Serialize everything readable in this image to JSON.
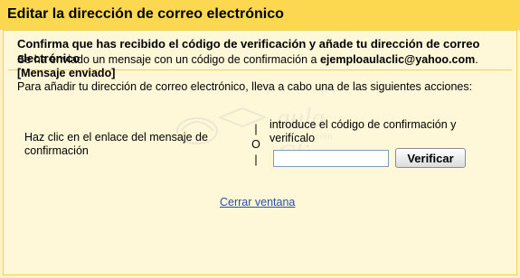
{
  "window": {
    "title": "Editar la dirección de correo electrónico"
  },
  "header": {
    "text": "Confirma que has recibido el código de verificación y añade tu dirección de correo electrónico"
  },
  "info": {
    "line1_prefix": "Se ha enviado un mensaje con un código de confirmación a ",
    "email": "ejemploaulaclic@yahoo.com",
    "line1_suffix": ".",
    "sent_label": "[Mensaje enviado]",
    "instructions": "Para añadir tu dirección de correo electrónico, lleva a cabo una de las siguientes acciones:"
  },
  "options": {
    "left_text": "Haz clic en el enlace del mensaje de confirmación",
    "separator": [
      "|",
      "O",
      "|"
    ],
    "right_text": "introduce el código de confirmación y verifícalo",
    "code_input_value": "",
    "verify_label": "Verificar"
  },
  "footer": {
    "close_label": "Cerrar ventana"
  },
  "watermark": {
    "brand": "aula Clic",
    "domain": ".com"
  },
  "colors": {
    "title_bar": "#fbd84f",
    "background": "#fdf3c4",
    "panel": "#fff8d8",
    "border": "#f3cf52",
    "link": "#2a4fa8"
  }
}
